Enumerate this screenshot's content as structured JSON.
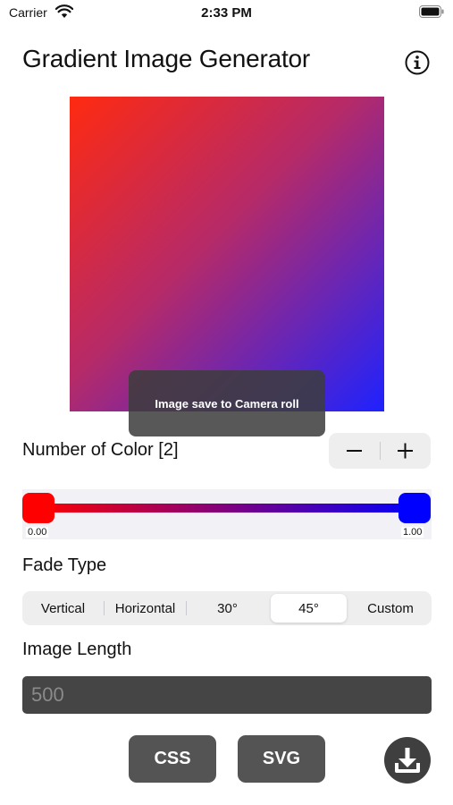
{
  "status_bar": {
    "carrier": "Carrier",
    "time": "2:33 PM"
  },
  "header": {
    "title": "Gradient Image Generator",
    "info_icon": "info-circle-icon"
  },
  "preview": {
    "start_color": "#ff2a10",
    "end_color": "#1e22ff",
    "angle": "45°"
  },
  "toast": {
    "message": "Image save to Camera roll"
  },
  "colors": {
    "label": "Number of Color [2]",
    "stops": [
      {
        "color": "#ff0000",
        "position_label": "0.00"
      },
      {
        "color": "#0000ff",
        "position_label": "1.00"
      }
    ]
  },
  "fade": {
    "label": "Fade Type",
    "options": [
      "Vertical",
      "Horizontal",
      "30°",
      "45°",
      "Custom"
    ],
    "selected": "45°"
  },
  "length": {
    "label": "Image Length",
    "placeholder": "500",
    "value": ""
  },
  "actions": {
    "css_label": "CSS",
    "svg_label": "SVG",
    "download_icon": "download-icon"
  }
}
